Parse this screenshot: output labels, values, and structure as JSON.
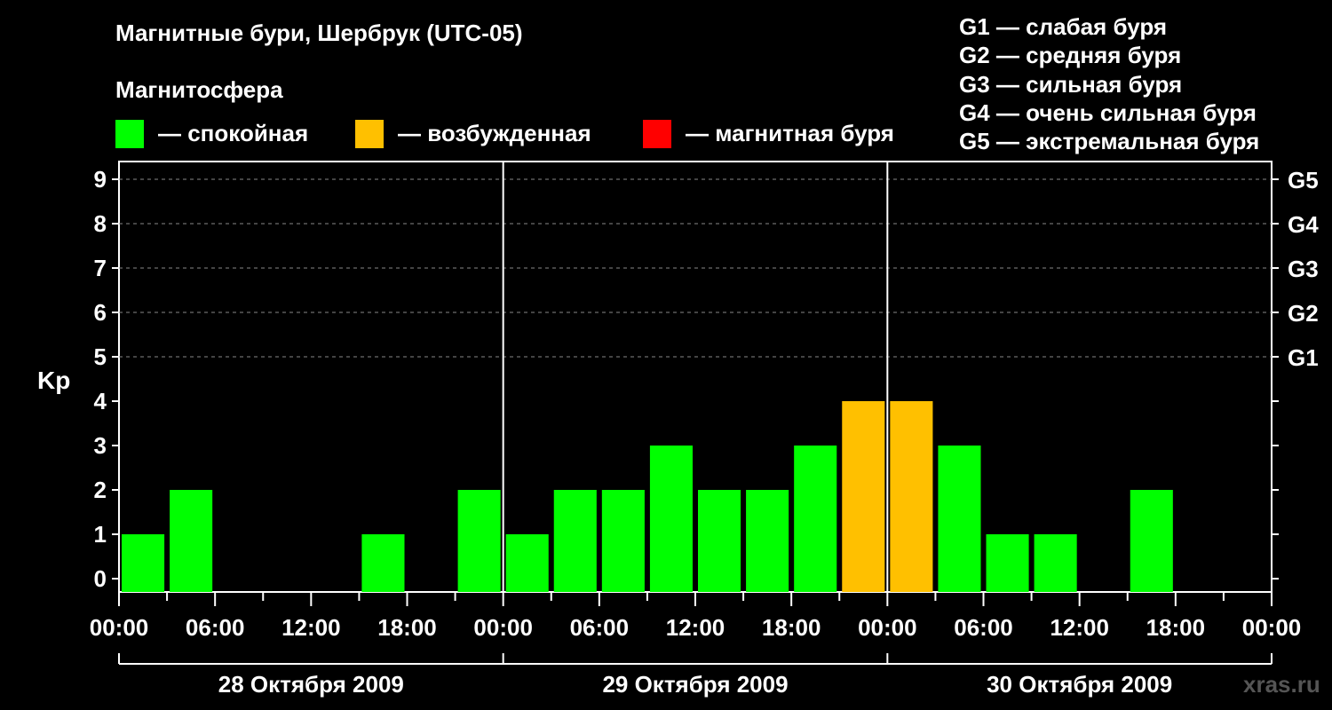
{
  "title": "Магнитные бури, Шербрук (UTC-05)",
  "subtitle": "Магнитосфера",
  "legend": [
    {
      "label": "— спокойная",
      "color": "#00ff00"
    },
    {
      "label": "— возбужденная",
      "color": "#ffc000"
    },
    {
      "label": "— магнитная буря",
      "color": "#ff0000"
    }
  ],
  "g_scale": [
    "G1 — слабая буря",
    "G2 — средняя буря",
    "G3 — сильная буря",
    "G4 — очень сильная буря",
    "G5 — экстремальная буря"
  ],
  "watermark": "xras.ru",
  "chart_data": {
    "type": "bar",
    "ylabel": "Kp",
    "ylim": [
      0,
      9
    ],
    "yticks": [
      0,
      1,
      2,
      3,
      4,
      5,
      6,
      7,
      8,
      9
    ],
    "right_labels": [
      {
        "value": 5,
        "label": "G1"
      },
      {
        "value": 6,
        "label": "G2"
      },
      {
        "value": 7,
        "label": "G3"
      },
      {
        "value": 8,
        "label": "G4"
      },
      {
        "value": 9,
        "label": "G5"
      }
    ],
    "x_tick_labels": [
      "00:00",
      "06:00",
      "12:00",
      "18:00",
      "00:00",
      "06:00",
      "12:00",
      "18:00",
      "00:00",
      "06:00",
      "12:00",
      "18:00",
      "00:00"
    ],
    "days": [
      "28 Октября 2009",
      "29 Октября 2009",
      "30 Октября 2009"
    ],
    "interval_hours": 3,
    "values": [
      1,
      2,
      0,
      0,
      0,
      1,
      0,
      2,
      1,
      2,
      2,
      3,
      2,
      2,
      3,
      4,
      4,
      3,
      1,
      1,
      0,
      2,
      0,
      0
    ],
    "colors": {
      "quiet": "#00ff00",
      "active": "#ffc000",
      "storm": "#ff0000"
    },
    "grid": "dashed at Kp 5-9"
  }
}
